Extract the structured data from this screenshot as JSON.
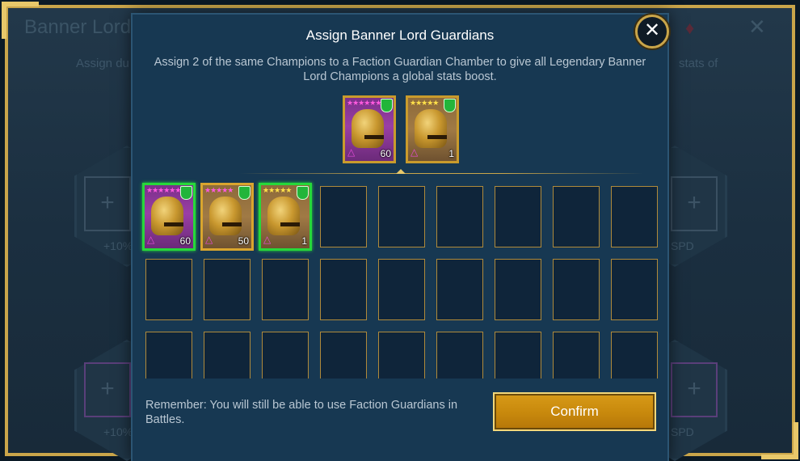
{
  "background": {
    "title": "Banner Lord",
    "subtitle_left": "Assign du",
    "subtitle_right": "stats of",
    "slot_plus": "+",
    "labels": {
      "pct_top": "+10%",
      "spd_top": "SPD",
      "pct_bottom": "+10%",
      "spd_bottom": "SPD"
    },
    "gem_icon": "gem-icon",
    "close_icon": "close-icon"
  },
  "modal": {
    "title": "Assign Banner Lord Guardians",
    "description": "Assign 2 of the same Champions to a Faction Guardian Chamber to give all Legendary Banner Lord Champions a global stats boost.",
    "close_label": "✕",
    "footer_note": "Remember: You will still be able to use Faction Guardians in Battles.",
    "confirm_label": "Confirm"
  },
  "assigned": [
    {
      "level": "60",
      "stars": "★★★★★★",
      "star_color": "pink",
      "affinity_glyph": "△"
    },
    {
      "level": "1",
      "stars": "★★★★★",
      "star_color": "yellow",
      "affinity_glyph": "△"
    }
  ],
  "champions": [
    {
      "level": "60",
      "stars": "★★★★★★",
      "star_color": "pink",
      "affinity_glyph": "△",
      "selected": true
    },
    {
      "level": "50",
      "stars": "★★★★★",
      "star_color": "pink",
      "affinity_glyph": "△",
      "selected": false
    },
    {
      "level": "1",
      "stars": "★★★★★",
      "star_color": "yellow",
      "affinity_glyph": "△",
      "selected": true
    }
  ],
  "colors": {
    "modal_bg": "#173852",
    "gold_accent": "#c9a54a",
    "selected_border": "#27d83a",
    "confirm_bg": "#c98a0d"
  }
}
